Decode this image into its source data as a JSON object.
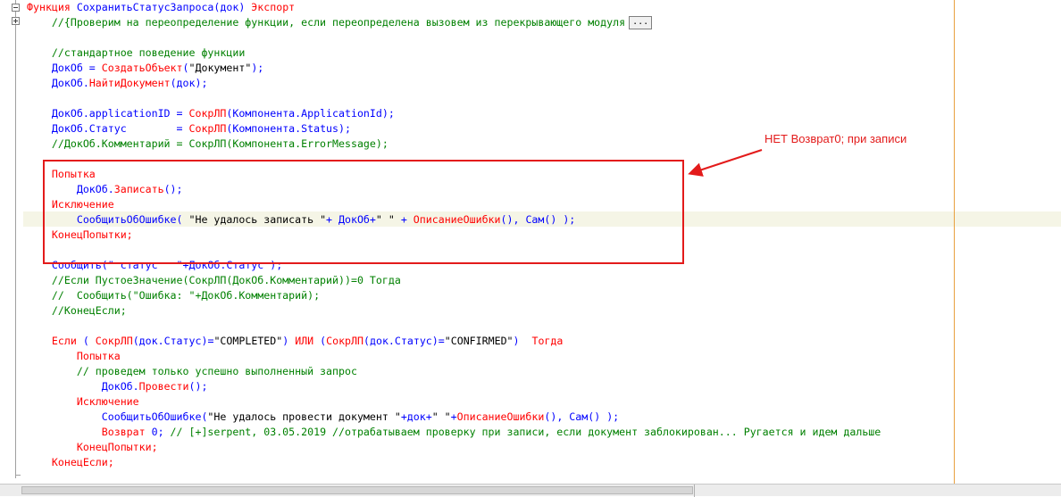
{
  "code_lines": [
    [
      {
        "t": "Функция ",
        "c": "k"
      },
      {
        "t": "СохранитьСтатусЗапроса",
        "c": "b"
      },
      {
        "t": "(док) ",
        "c": "b"
      },
      {
        "t": "Экспорт",
        "c": "k"
      }
    ],
    [
      {
        "t": "    //{Проверим на переопределение функции, если переопределена вызовем из перекрывающего модуля",
        "c": "g"
      }
    ],
    [],
    [
      {
        "t": "    //стандартное поведение функции",
        "c": "g"
      }
    ],
    [
      {
        "t": "    ДокОб = ",
        "c": "b"
      },
      {
        "t": "СоздатьОбъект",
        "c": "k"
      },
      {
        "t": "(",
        "c": "b"
      },
      {
        "t": "\"Документ\"",
        "c": "t"
      },
      {
        "t": ");",
        "c": "b"
      }
    ],
    [
      {
        "t": "    ДокОб.",
        "c": "b"
      },
      {
        "t": "НайтиДокумент",
        "c": "k"
      },
      {
        "t": "(док);",
        "c": "b"
      }
    ],
    [],
    [
      {
        "t": "    ДокОб.applicationID = ",
        "c": "b"
      },
      {
        "t": "СокрЛП",
        "c": "k"
      },
      {
        "t": "(Компонента.ApplicationId);",
        "c": "b"
      }
    ],
    [
      {
        "t": "    ДокОб.Статус        = ",
        "c": "b"
      },
      {
        "t": "СокрЛП",
        "c": "k"
      },
      {
        "t": "(Компонента.Status);",
        "c": "b"
      }
    ],
    [
      {
        "t": "    //ДокОб.Комментарий = СокрЛП(Компонента.ErrorMessage);",
        "c": "g"
      }
    ],
    [],
    [
      {
        "t": "    Попытка",
        "c": "k"
      }
    ],
    [
      {
        "t": "        ДокОб.",
        "c": "b"
      },
      {
        "t": "Записать",
        "c": "k"
      },
      {
        "t": "();",
        "c": "b"
      }
    ],
    [
      {
        "t": "    Исключение",
        "c": "k"
      }
    ],
    [
      {
        "t": "        СообщитьОбОшибке( ",
        "c": "b"
      },
      {
        "t": "\"Не удалось записать \"",
        "c": "t"
      },
      {
        "t": "+ ДокОб+",
        "c": "b"
      },
      {
        "t": "\" \"",
        "c": "t"
      },
      {
        "t": " + ",
        "c": "b"
      },
      {
        "t": "ОписаниеОшибки",
        "c": "k"
      },
      {
        "t": "(), Сам() );",
        "c": "b"
      }
    ],
    [
      {
        "t": "    КонецПопытки;",
        "c": "k"
      }
    ],
    [],
    [
      {
        "t": "    Сообщить(\" статус   \"+ДокОб.Статус );",
        "c": "b"
      }
    ],
    [
      {
        "t": "    //Если ПустоеЗначение(СокрЛП(ДокОб.Комментарий))=0 Тогда",
        "c": "g"
      }
    ],
    [
      {
        "t": "    //  Сообщить(\"Ошибка: \"+ДокОб.Комментарий);",
        "c": "g"
      }
    ],
    [
      {
        "t": "    //КонецЕсли;",
        "c": "g"
      }
    ],
    [],
    [
      {
        "t": "    Если",
        "c": "k"
      },
      {
        "t": " ( ",
        "c": "b"
      },
      {
        "t": "СокрЛП",
        "c": "k"
      },
      {
        "t": "(док.Статус)=",
        "c": "b"
      },
      {
        "t": "\"COMPLETED\"",
        "c": "t"
      },
      {
        "t": ") ",
        "c": "b"
      },
      {
        "t": "ИЛИ",
        "c": "k"
      },
      {
        "t": " (",
        "c": "b"
      },
      {
        "t": "СокрЛП",
        "c": "k"
      },
      {
        "t": "(док.Статус)=",
        "c": "b"
      },
      {
        "t": "\"CONFIRMED\"",
        "c": "t"
      },
      {
        "t": ")  ",
        "c": "b"
      },
      {
        "t": "Тогда",
        "c": "k"
      }
    ],
    [
      {
        "t": "        Попытка",
        "c": "k"
      }
    ],
    [
      {
        "t": "        // проведем только успешно выполненный запрос",
        "c": "g"
      }
    ],
    [
      {
        "t": "            ДокОб.",
        "c": "b"
      },
      {
        "t": "Провести",
        "c": "k"
      },
      {
        "t": "();",
        "c": "b"
      }
    ],
    [
      {
        "t": "        Исключение",
        "c": "k"
      }
    ],
    [
      {
        "t": "            СообщитьОбОшибке(",
        "c": "b"
      },
      {
        "t": "\"Не удалось провести документ \"",
        "c": "t"
      },
      {
        "t": "+док+",
        "c": "b"
      },
      {
        "t": "\" \"",
        "c": "t"
      },
      {
        "t": "+",
        "c": "b"
      },
      {
        "t": "ОписаниеОшибки",
        "c": "k"
      },
      {
        "t": "(), Сам() );",
        "c": "b"
      }
    ],
    [
      {
        "t": "            Возврат",
        "c": "k"
      },
      {
        "t": " 0; ",
        "c": "b"
      },
      {
        "t": "// [+]serpent, 03.05.2019 //отрабатываем проверку при записи, если документ заблокирован... Ругается и идем дальше",
        "c": "g"
      }
    ],
    [
      {
        "t": "        КонецПопытки;",
        "c": "k"
      }
    ],
    [
      {
        "t": "    КонецЕсли;",
        "c": "k"
      }
    ]
  ],
  "collapsed_region_label": "...",
  "annotation": {
    "text": "НЕТ Возврат0; при записи",
    "color": "#e31b1b"
  },
  "colors": {
    "keyword": "#ff0000",
    "identifier": "#0000ff",
    "comment": "#008000",
    "string": "#000000"
  }
}
